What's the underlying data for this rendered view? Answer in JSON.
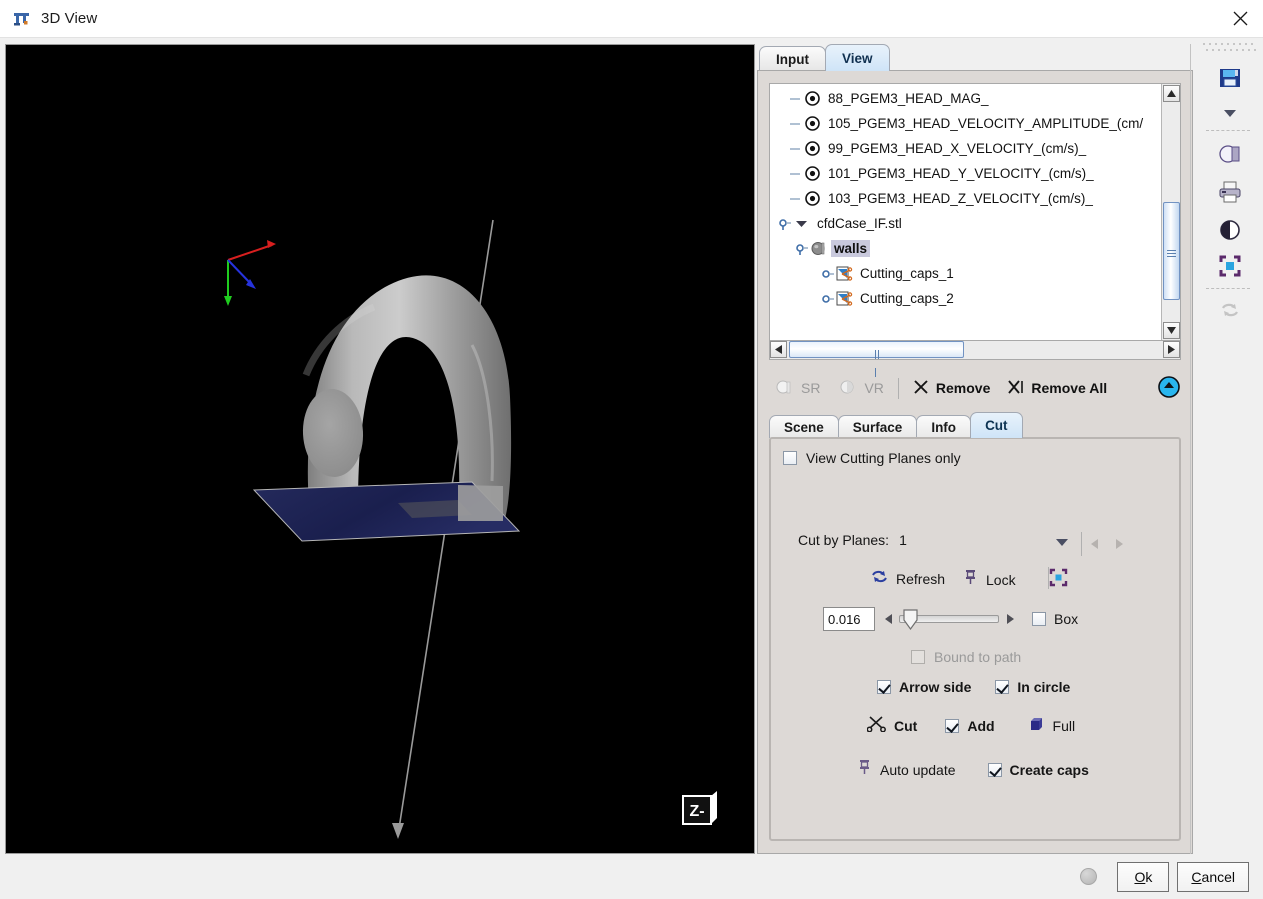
{
  "window": {
    "title": "3D View",
    "icon": "app-icon",
    "close_label": "✕"
  },
  "top_tabs": [
    {
      "label": "Input",
      "active": false
    },
    {
      "label": "View",
      "active": true
    }
  ],
  "tree": {
    "items": [
      {
        "label": "88_PGEM3_HEAD_MAG_",
        "indent": 0,
        "icon": "target-icon",
        "selected": false
      },
      {
        "label": "105_PGEM3_HEAD_VELOCITY_AMPLITUDE_(cm/",
        "indent": 0,
        "icon": "target-icon",
        "selected": false
      },
      {
        "label": "99_PGEM3_HEAD_X_VELOCITY_(cm/s)_",
        "indent": 0,
        "icon": "target-icon",
        "selected": false
      },
      {
        "label": "101_PGEM3_HEAD_Y_VELOCITY_(cm/s)_",
        "indent": 0,
        "icon": "target-icon",
        "selected": false
      },
      {
        "label": "103_PGEM3_HEAD_Z_VELOCITY_(cm/s)_",
        "indent": 0,
        "icon": "target-icon",
        "selected": false
      },
      {
        "label": "cfdCase_IF.stl",
        "indent": 0,
        "icon": "collapse-arrow-icon",
        "selected": false
      },
      {
        "label": "walls",
        "indent": 1,
        "icon": "mesh-icon",
        "selected": true
      },
      {
        "label": "Cutting_caps_1",
        "indent": 2,
        "icon": "cut-caps-icon",
        "selected": false
      },
      {
        "label": "Cutting_caps_2",
        "indent": 2,
        "icon": "cut-caps-icon",
        "selected": false
      }
    ]
  },
  "actions": {
    "sr": "SR",
    "vr": "VR",
    "remove": "Remove",
    "remove_all": "Remove All",
    "collapse_button": "collapse-up-button"
  },
  "sub_tabs": [
    {
      "label": "Scene",
      "active": false
    },
    {
      "label": "Surface",
      "active": false
    },
    {
      "label": "Info",
      "active": false
    },
    {
      "label": "Cut",
      "active": true
    }
  ],
  "cut_panel": {
    "view_cutting_planes_only": "View Cutting Planes only",
    "view_cutting_planes_only_checked": false,
    "cut_by_planes_label": "Cut by Planes:",
    "cut_by_planes_value": "1",
    "refresh": "Refresh",
    "lock": "Lock",
    "fit_icon": "fit-selection-icon",
    "slider_value": "0.016",
    "slider_percent": 8,
    "box_label": "Box",
    "box_checked": false,
    "bound_to_path": "Bound to path",
    "bound_to_path_checked": false,
    "bound_to_path_enabled": false,
    "arrow_side": "Arrow side",
    "arrow_side_checked": true,
    "in_circle": "In circle",
    "in_circle_checked": true,
    "cut": "Cut",
    "add": "Add",
    "add_checked": true,
    "full": "Full",
    "auto_update": "Auto update",
    "create_caps": "Create caps",
    "create_caps_checked": true
  },
  "viewport": {
    "orientation_label": "Z-",
    "axes": [
      {
        "name": "x-axis",
        "color": "#d81f1f"
      },
      {
        "name": "y-axis",
        "color": "#1fcc1f"
      },
      {
        "name": "z-axis",
        "color": "#2633dd"
      }
    ],
    "background": "#000000",
    "surface_color": "#a8a8a8",
    "cut_plane_color": "#1e2352"
  },
  "vtoolbar": {
    "items": [
      {
        "name": "save-icon"
      },
      {
        "name": "dropdown-arrow-icon"
      },
      {
        "name": "snapshot-icon"
      },
      {
        "name": "print-icon"
      },
      {
        "name": "contrast-icon"
      },
      {
        "name": "fit-view-icon"
      },
      {
        "name": "refresh-icon-disabled"
      }
    ]
  },
  "footer": {
    "ok": "Ok",
    "ok_mnemonic": "O",
    "cancel": "Cancel",
    "cancel_mnemonic": "C"
  }
}
